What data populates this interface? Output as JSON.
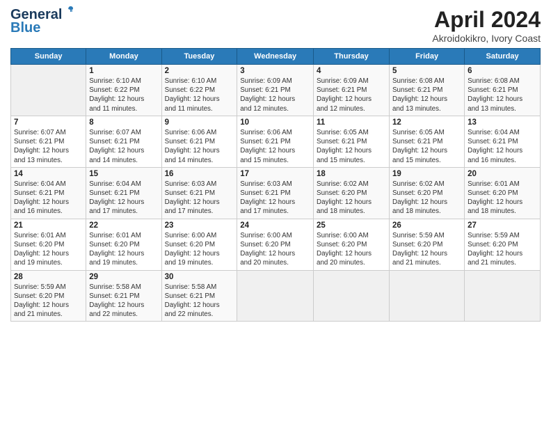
{
  "header": {
    "logo_line1": "General",
    "logo_line2": "Blue",
    "month_title": "April 2024",
    "subtitle": "Akroidokikro, Ivory Coast"
  },
  "weekdays": [
    "Sunday",
    "Monday",
    "Tuesday",
    "Wednesday",
    "Thursday",
    "Friday",
    "Saturday"
  ],
  "weeks": [
    [
      {
        "day": "",
        "info": ""
      },
      {
        "day": "1",
        "info": "Sunrise: 6:10 AM\nSunset: 6:22 PM\nDaylight: 12 hours\nand 11 minutes."
      },
      {
        "day": "2",
        "info": "Sunrise: 6:10 AM\nSunset: 6:22 PM\nDaylight: 12 hours\nand 11 minutes."
      },
      {
        "day": "3",
        "info": "Sunrise: 6:09 AM\nSunset: 6:21 PM\nDaylight: 12 hours\nand 12 minutes."
      },
      {
        "day": "4",
        "info": "Sunrise: 6:09 AM\nSunset: 6:21 PM\nDaylight: 12 hours\nand 12 minutes."
      },
      {
        "day": "5",
        "info": "Sunrise: 6:08 AM\nSunset: 6:21 PM\nDaylight: 12 hours\nand 13 minutes."
      },
      {
        "day": "6",
        "info": "Sunrise: 6:08 AM\nSunset: 6:21 PM\nDaylight: 12 hours\nand 13 minutes."
      }
    ],
    [
      {
        "day": "7",
        "info": "Sunrise: 6:07 AM\nSunset: 6:21 PM\nDaylight: 12 hours\nand 13 minutes."
      },
      {
        "day": "8",
        "info": "Sunrise: 6:07 AM\nSunset: 6:21 PM\nDaylight: 12 hours\nand 14 minutes."
      },
      {
        "day": "9",
        "info": "Sunrise: 6:06 AM\nSunset: 6:21 PM\nDaylight: 12 hours\nand 14 minutes."
      },
      {
        "day": "10",
        "info": "Sunrise: 6:06 AM\nSunset: 6:21 PM\nDaylight: 12 hours\nand 15 minutes."
      },
      {
        "day": "11",
        "info": "Sunrise: 6:05 AM\nSunset: 6:21 PM\nDaylight: 12 hours\nand 15 minutes."
      },
      {
        "day": "12",
        "info": "Sunrise: 6:05 AM\nSunset: 6:21 PM\nDaylight: 12 hours\nand 15 minutes."
      },
      {
        "day": "13",
        "info": "Sunrise: 6:04 AM\nSunset: 6:21 PM\nDaylight: 12 hours\nand 16 minutes."
      }
    ],
    [
      {
        "day": "14",
        "info": "Sunrise: 6:04 AM\nSunset: 6:21 PM\nDaylight: 12 hours\nand 16 minutes."
      },
      {
        "day": "15",
        "info": "Sunrise: 6:04 AM\nSunset: 6:21 PM\nDaylight: 12 hours\nand 17 minutes."
      },
      {
        "day": "16",
        "info": "Sunrise: 6:03 AM\nSunset: 6:21 PM\nDaylight: 12 hours\nand 17 minutes."
      },
      {
        "day": "17",
        "info": "Sunrise: 6:03 AM\nSunset: 6:21 PM\nDaylight: 12 hours\nand 17 minutes."
      },
      {
        "day": "18",
        "info": "Sunrise: 6:02 AM\nSunset: 6:20 PM\nDaylight: 12 hours\nand 18 minutes."
      },
      {
        "day": "19",
        "info": "Sunrise: 6:02 AM\nSunset: 6:20 PM\nDaylight: 12 hours\nand 18 minutes."
      },
      {
        "day": "20",
        "info": "Sunrise: 6:01 AM\nSunset: 6:20 PM\nDaylight: 12 hours\nand 18 minutes."
      }
    ],
    [
      {
        "day": "21",
        "info": "Sunrise: 6:01 AM\nSunset: 6:20 PM\nDaylight: 12 hours\nand 19 minutes."
      },
      {
        "day": "22",
        "info": "Sunrise: 6:01 AM\nSunset: 6:20 PM\nDaylight: 12 hours\nand 19 minutes."
      },
      {
        "day": "23",
        "info": "Sunrise: 6:00 AM\nSunset: 6:20 PM\nDaylight: 12 hours\nand 19 minutes."
      },
      {
        "day": "24",
        "info": "Sunrise: 6:00 AM\nSunset: 6:20 PM\nDaylight: 12 hours\nand 20 minutes."
      },
      {
        "day": "25",
        "info": "Sunrise: 6:00 AM\nSunset: 6:20 PM\nDaylight: 12 hours\nand 20 minutes."
      },
      {
        "day": "26",
        "info": "Sunrise: 5:59 AM\nSunset: 6:20 PM\nDaylight: 12 hours\nand 21 minutes."
      },
      {
        "day": "27",
        "info": "Sunrise: 5:59 AM\nSunset: 6:20 PM\nDaylight: 12 hours\nand 21 minutes."
      }
    ],
    [
      {
        "day": "28",
        "info": "Sunrise: 5:59 AM\nSunset: 6:20 PM\nDaylight: 12 hours\nand 21 minutes."
      },
      {
        "day": "29",
        "info": "Sunrise: 5:58 AM\nSunset: 6:21 PM\nDaylight: 12 hours\nand 22 minutes."
      },
      {
        "day": "30",
        "info": "Sunrise: 5:58 AM\nSunset: 6:21 PM\nDaylight: 12 hours\nand 22 minutes."
      },
      {
        "day": "",
        "info": ""
      },
      {
        "day": "",
        "info": ""
      },
      {
        "day": "",
        "info": ""
      },
      {
        "day": "",
        "info": ""
      }
    ]
  ]
}
